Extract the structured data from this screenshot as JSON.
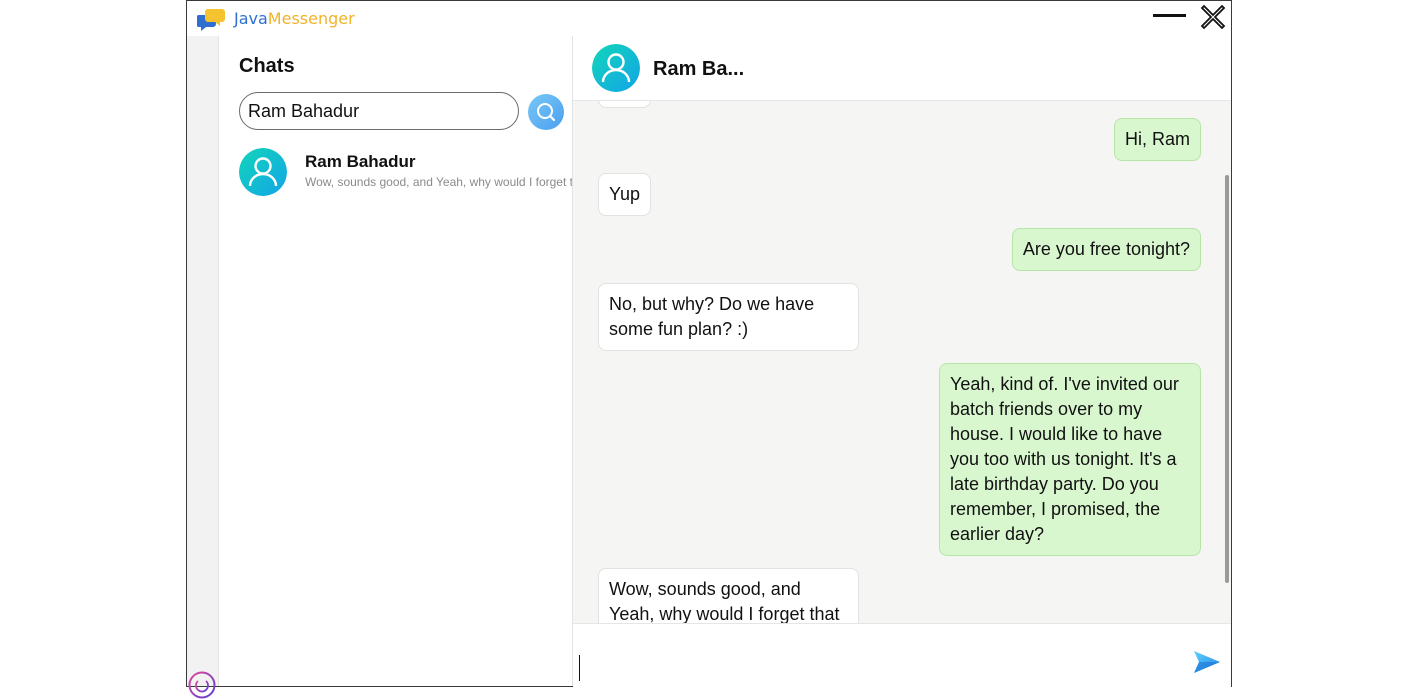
{
  "app": {
    "name_part1": "Java",
    "name_part2": "Messenger"
  },
  "sidebar": {
    "title": "Chats"
  },
  "search": {
    "value": "Ram Bahadur",
    "placeholder": ""
  },
  "chat_list": [
    {
      "name": "Ram Bahadur",
      "preview": "Wow, sounds good, and Yeah, why would I forget that"
    }
  ],
  "conversation": {
    "contact_name": "Ram Ba...",
    "messages": [
      {
        "direction": "in",
        "text": ""
      },
      {
        "direction": "out",
        "text": "Hi, Ram"
      },
      {
        "direction": "in",
        "text": "Yup"
      },
      {
        "direction": "out",
        "text": "Are you free tonight?"
      },
      {
        "direction": "in",
        "text": "No, but why? Do we have some fun plan? :)"
      },
      {
        "direction": "out",
        "text": "Yeah, kind of. I've invited our batch friends over to my house. I would like to have you too with us tonight. It's a late birthday party. Do you remember, I promised, the earlier day?"
      },
      {
        "direction": "in",
        "text": "Wow, sounds good, and Yeah, why would I forget that"
      }
    ]
  },
  "composer": {
    "value": "",
    "placeholder": ""
  },
  "colors": {
    "accent_blue": "#2f6fd1",
    "accent_yellow": "#f0b32a",
    "outgoing_bubble": "#d9f7cf",
    "incoming_bubble": "#ffffff",
    "avatar_gradient": [
      "#0fd3c0",
      "#11a8e6"
    ]
  },
  "icons": [
    "app-logo-icon",
    "minimize-icon",
    "close-icon",
    "search-icon",
    "avatar-icon",
    "power-icon",
    "send-icon"
  ]
}
